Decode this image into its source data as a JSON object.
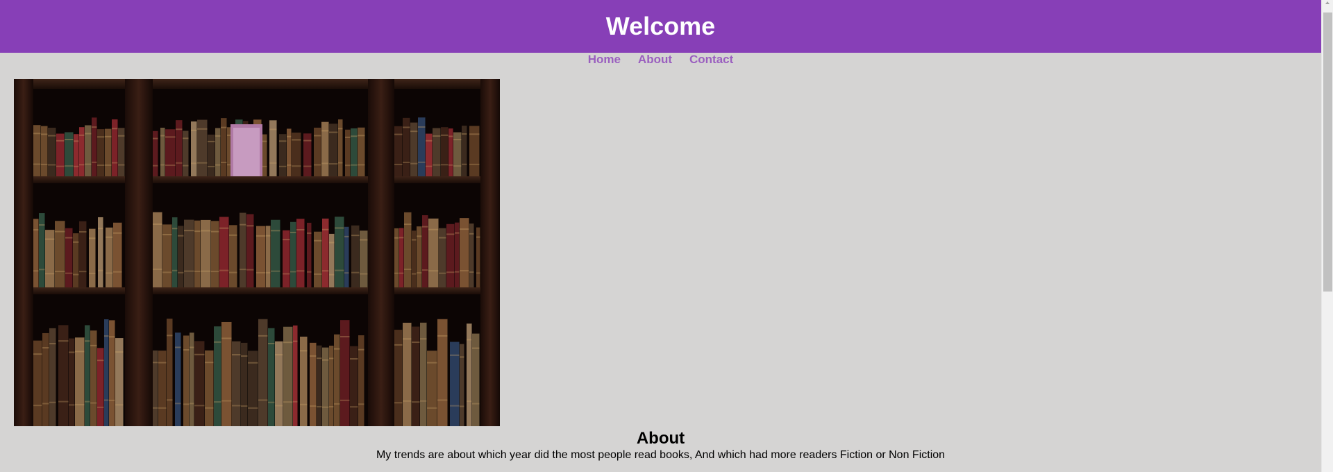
{
  "header": {
    "title": "Welcome",
    "background_color": "#873fb7"
  },
  "nav": {
    "items": [
      {
        "label": "Home"
      },
      {
        "label": "About"
      },
      {
        "label": "Contact"
      }
    ],
    "link_color": "#9a5fbf"
  },
  "hero": {
    "image_subject": "bookshelf-with-antique-books"
  },
  "about": {
    "heading": "About",
    "text": "My trends are about which year did the most people read books, And which had more readers Fiction or Non Fiction"
  },
  "scrollbar": {
    "icons": [
      "scroll-up-arrow-icon"
    ]
  },
  "colors": {
    "page_background": "#d5d4d3",
    "header_text": "#ffffff"
  }
}
